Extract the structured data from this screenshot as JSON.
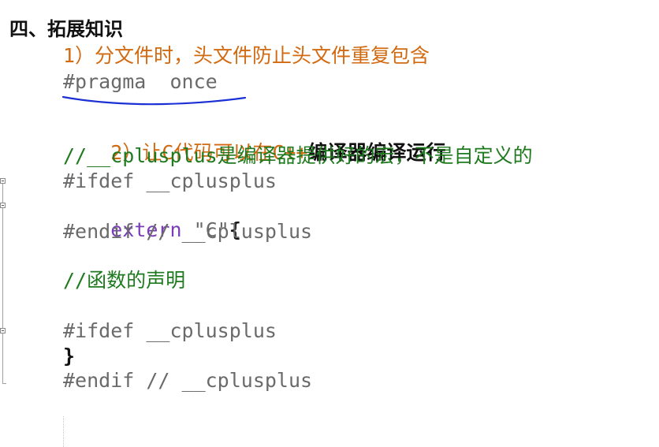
{
  "heading": "四、拓展知识",
  "lines": {
    "item1": "1）分文件时，头文件防止头文件重复包含",
    "pragma": "#pragma  once",
    "item2_prefix": "2）让C代码可以在C++",
    "item2_suffix": "编译器编译运行",
    "comment_macro": "//__cplusplus是编译器提供好的宏，不是自定义的",
    "ifdef1": "#ifdef __cplusplus",
    "extern_kw": "extern",
    "extern_str": "\"C\"",
    "extern_brace": "{",
    "endif1": "#endif // __cplusplus",
    "comment_func": "//函数的声明",
    "ifdef2": "#ifdef __cplusplus",
    "close_brace": "}",
    "endif2": "#endif // __cplusplus"
  },
  "colors": {
    "orange": "#d26a12",
    "green": "#1f7a1f",
    "gray": "#6a6a6a",
    "purple": "#7a3db8",
    "annotation_blue": "#1a2fd6"
  }
}
